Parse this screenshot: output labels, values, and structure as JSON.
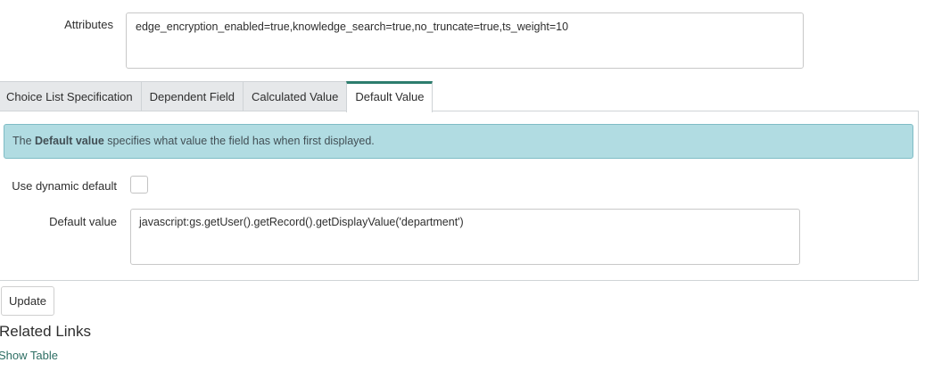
{
  "attributes": {
    "label": "Attributes",
    "value": "edge_encryption_enabled=true,knowledge_search=true,no_truncate=true,ts_weight=10"
  },
  "tabs": [
    {
      "label": "Choice List Specification",
      "active": false
    },
    {
      "label": "Dependent Field",
      "active": false
    },
    {
      "label": "Calculated Value",
      "active": false
    },
    {
      "label": "Default Value",
      "active": true
    }
  ],
  "default_tab": {
    "info": {
      "prefix": "The ",
      "bold": "Default value",
      "suffix": " specifies what value the field has when first displayed."
    },
    "use_dynamic_default": {
      "label": "Use dynamic default",
      "checked": false
    },
    "default_value": {
      "label": "Default value",
      "value": "javascript:gs.getUser().getRecord().getDisplayValue('department')"
    }
  },
  "actions": {
    "update_label": "Update"
  },
  "related_links": {
    "title": "Related Links",
    "links": [
      "Show Table"
    ]
  },
  "colors": {
    "accent": "#2d7d6e",
    "info_bg": "#b1dce2",
    "link": "#2d6e63"
  }
}
